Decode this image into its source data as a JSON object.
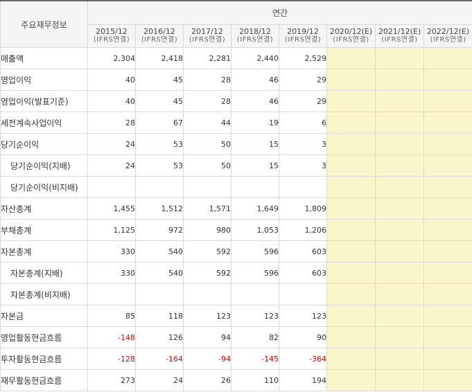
{
  "header": {
    "corner_label": "주요재무정보",
    "group_label": "연간",
    "years": [
      {
        "year": "2015/12",
        "basis": "(IFRS연결)"
      },
      {
        "year": "2016/12",
        "basis": "(IFRS연결)"
      },
      {
        "year": "2017/12",
        "basis": "(IFRS연결)"
      },
      {
        "year": "2018/12",
        "basis": "(IFRS연결)"
      },
      {
        "year": "2019/12",
        "basis": "(IFRS연결)"
      },
      {
        "year": "2020/12(E)",
        "basis": "(IFRS연결)"
      },
      {
        "year": "2021/12(E)",
        "basis": "(IFRS연결)"
      },
      {
        "year": "2022/12(E)",
        "basis": "(IFRS연결)"
      }
    ]
  },
  "colors": {
    "estimate_bg": "#fbf5cc",
    "negative_text": "#e00000",
    "header_bg": "#f5f5f5",
    "border": "#d9d9d9"
  },
  "rows": [
    {
      "label": "매출액",
      "indent": false,
      "values": [
        "2,304",
        "2,418",
        "2,281",
        "2,440",
        "2,529",
        "",
        "",
        ""
      ]
    },
    {
      "label": "영업이익",
      "indent": false,
      "values": [
        "40",
        "45",
        "28",
        "46",
        "29",
        "",
        "",
        ""
      ]
    },
    {
      "label": "영업이익(발표기준)",
      "indent": false,
      "values": [
        "40",
        "45",
        "28",
        "46",
        "29",
        "",
        "",
        ""
      ]
    },
    {
      "label": "세전계속사업이익",
      "indent": false,
      "values": [
        "28",
        "67",
        "44",
        "19",
        "6",
        "",
        "",
        ""
      ]
    },
    {
      "label": "당기순이익",
      "indent": false,
      "values": [
        "24",
        "53",
        "50",
        "15",
        "3",
        "",
        "",
        ""
      ]
    },
    {
      "label": "당기순이익(지배)",
      "indent": true,
      "values": [
        "24",
        "53",
        "50",
        "15",
        "3",
        "",
        "",
        ""
      ]
    },
    {
      "label": "당기순이익(비지배)",
      "indent": true,
      "values": [
        "",
        "",
        "",
        "",
        "",
        "",
        "",
        ""
      ]
    },
    {
      "label": "자산총계",
      "indent": false,
      "values": [
        "1,455",
        "1,512",
        "1,571",
        "1,649",
        "1,809",
        "",
        "",
        ""
      ]
    },
    {
      "label": "부채총계",
      "indent": false,
      "values": [
        "1,125",
        "972",
        "980",
        "1,053",
        "1,206",
        "",
        "",
        ""
      ]
    },
    {
      "label": "자본총계",
      "indent": false,
      "values": [
        "330",
        "540",
        "592",
        "596",
        "603",
        "",
        "",
        ""
      ]
    },
    {
      "label": "자본총계(지배)",
      "indent": true,
      "values": [
        "330",
        "540",
        "592",
        "596",
        "603",
        "",
        "",
        ""
      ]
    },
    {
      "label": "자본총계(비지배)",
      "indent": true,
      "values": [
        "",
        "",
        "",
        "",
        "",
        "",
        "",
        ""
      ]
    },
    {
      "label": "자본금",
      "indent": false,
      "values": [
        "85",
        "118",
        "123",
        "123",
        "123",
        "",
        "",
        ""
      ]
    },
    {
      "label": "영업활동현금흐름",
      "indent": false,
      "values": [
        "-148",
        "126",
        "94",
        "82",
        "90",
        "",
        "",
        ""
      ]
    },
    {
      "label": "투자활동현금흐름",
      "indent": false,
      "values": [
        "-128",
        "-164",
        "-94",
        "-145",
        "-364",
        "",
        "",
        ""
      ]
    },
    {
      "label": "재무활동현금흐름",
      "indent": false,
      "values": [
        "273",
        "24",
        "26",
        "110",
        "194",
        "",
        "",
        ""
      ]
    }
  ]
}
